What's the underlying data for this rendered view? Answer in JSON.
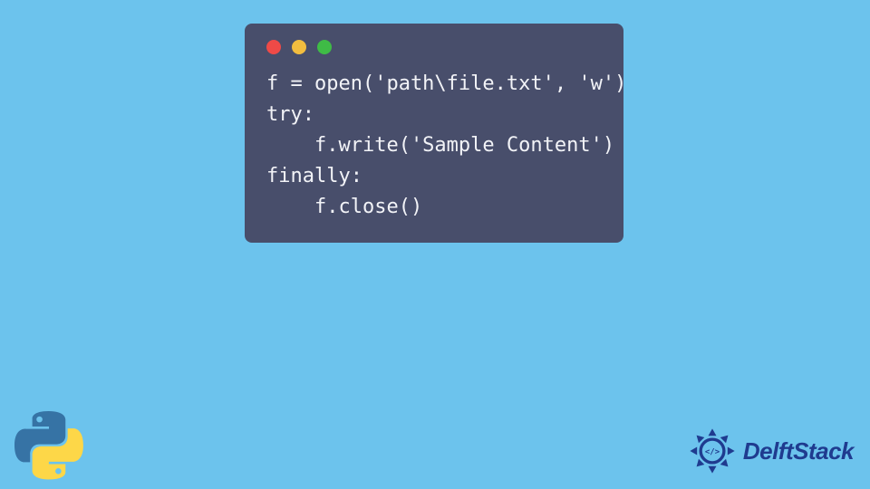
{
  "code": {
    "lines": [
      "f = open('path\\file.txt', 'w')",
      "try:",
      "    f.write('Sample Content')",
      "finally:",
      "    f.close()"
    ]
  },
  "colors": {
    "background": "#6cc3ed",
    "card": "#484e6b",
    "dot_red": "#ef4a47",
    "dot_yellow": "#f2bd3f",
    "dot_green": "#3fbb46",
    "python_blue": "#3673a5",
    "python_yellow": "#fdd748",
    "brand_blue": "#1f3b8f"
  },
  "brand": {
    "name": "DelftStack"
  },
  "icons": {
    "python": "python-logo",
    "brand_badge": "delftstack-badge"
  }
}
